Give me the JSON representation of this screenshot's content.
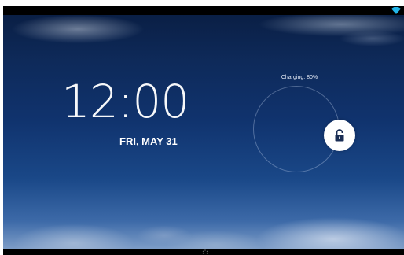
{
  "lockscreen": {
    "time": "12:00",
    "date": "FRI, MAY 31",
    "charging_status": "Charging, 80%",
    "unlock_icon": "unlock-icon"
  },
  "status_bar": {
    "icons": [
      "wifi-icon"
    ]
  },
  "colors": {
    "wallpaper_top": "#0a1f45",
    "wallpaper_bottom": "#7f9ec8",
    "text": "#ffffff",
    "wifi": "#22b5e8"
  }
}
